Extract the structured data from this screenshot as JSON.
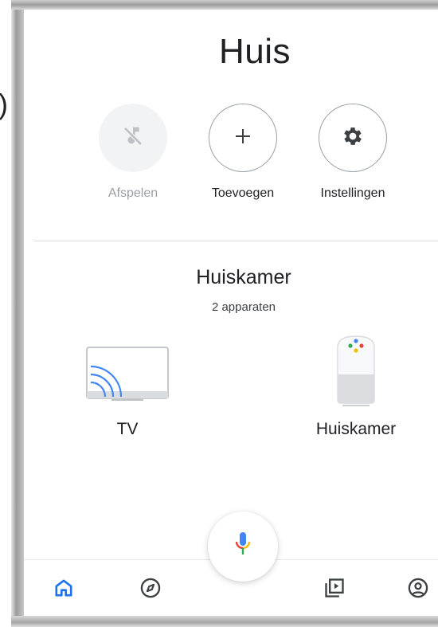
{
  "page": {
    "title": "Huis"
  },
  "stray_text": ")",
  "actions": [
    {
      "label": "Afspelen",
      "icon": "music-off-icon",
      "state": "disabled"
    },
    {
      "label": "Toevoegen",
      "icon": "plus-icon",
      "state": "enabled"
    },
    {
      "label": "Instellingen",
      "icon": "gear-icon",
      "state": "enabled"
    }
  ],
  "room": {
    "name": "Huiskamer",
    "device_count": "2 apparaten",
    "devices": [
      {
        "label": "TV",
        "icon": "cast-tv-icon"
      },
      {
        "label": "Huiskamer",
        "icon": "google-home-speaker-icon"
      }
    ]
  },
  "assistant": {
    "icon": "microphone-icon"
  },
  "nav": {
    "items": [
      {
        "name": "home",
        "icon": "home-icon",
        "active": true
      },
      {
        "name": "discover",
        "icon": "compass-icon",
        "active": false
      },
      {
        "name": "media",
        "icon": "media-icon",
        "active": false
      },
      {
        "name": "account",
        "icon": "account-icon",
        "active": false
      }
    ]
  },
  "colors": {
    "accent": "#1a73e8",
    "text": "#202124",
    "muted": "#9aa0a6",
    "divider": "#dadce0",
    "google_blue": "#4285f4",
    "google_red": "#ea4335",
    "google_yellow": "#fbbc04",
    "google_green": "#34a853"
  }
}
